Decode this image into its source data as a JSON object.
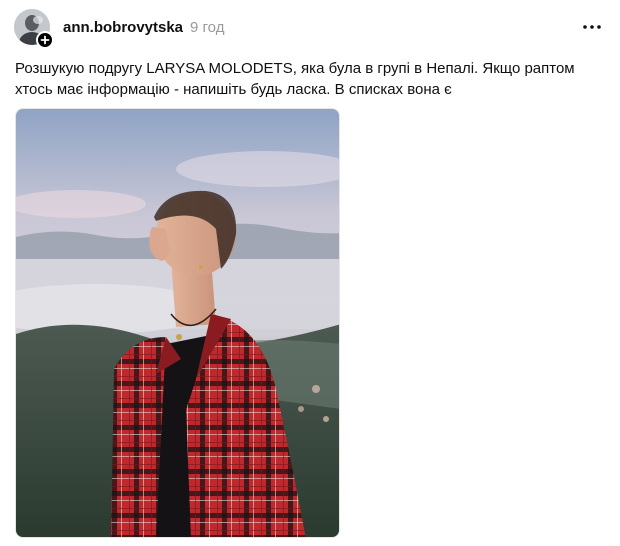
{
  "post": {
    "author": {
      "username": "ann.bobrovytska",
      "avatar_icon": "user-avatar"
    },
    "timestamp": "9 год",
    "text": "Розшукую подругу LARYSA MOLODETS, яка була в групі в Непалі. Якщо раптом хтось має інформацію - напишіть будь ласка. В списках вона є",
    "icons": {
      "follow": "plus-icon",
      "more": "more-horizontal-icon"
    },
    "image": {
      "subject": "woman-in-red-plaid-shirt-mountain-background"
    }
  },
  "colors": {
    "text_primary": "#101010",
    "text_secondary": "#999999",
    "background": "#ffffff",
    "badge": "#000000"
  }
}
